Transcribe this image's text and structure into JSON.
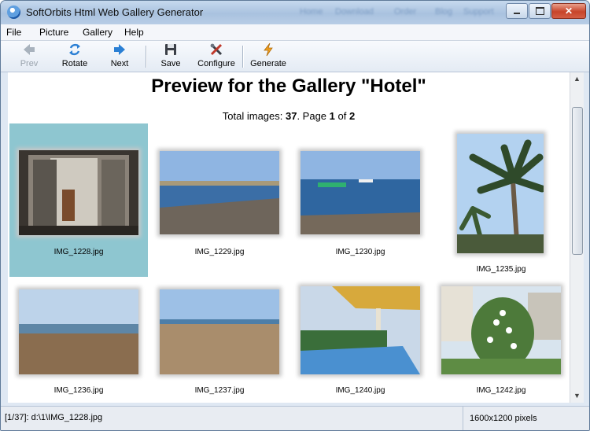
{
  "window": {
    "title": "SoftOrbits Html Web Gallery Generator",
    "controls": {
      "minimize": "minimize",
      "maximize": "maximize",
      "close": "✕"
    }
  },
  "background_blur_text": [
    "Home",
    "Download",
    "Order",
    "Blog",
    "Support"
  ],
  "menu": {
    "items": [
      "File",
      "Picture",
      "Gallery",
      "Help"
    ]
  },
  "toolbar": {
    "prev": {
      "label": "Prev",
      "enabled": false,
      "icon": "left-arrow-icon"
    },
    "rotate": {
      "label": "Rotate",
      "enabled": true,
      "icon": "rotate-icon"
    },
    "next": {
      "label": "Next",
      "enabled": true,
      "icon": "right-arrow-icon"
    },
    "save": {
      "label": "Save",
      "enabled": true,
      "icon": "floppy-disk-icon"
    },
    "configure": {
      "label": "Configure",
      "enabled": true,
      "icon": "tools-icon"
    },
    "generate": {
      "label": "Generate",
      "enabled": true,
      "icon": "lightning-icon"
    }
  },
  "gallery": {
    "title": "Preview for the Gallery \"Hotel\"",
    "total_label": "Total images: ",
    "total_images": "37",
    "page_label": ". Page ",
    "page": "1",
    "of_label": " of ",
    "page_count": "2",
    "selected_index": 0,
    "images": [
      {
        "filename": "IMG_1228.jpg",
        "scene": "lobby"
      },
      {
        "filename": "IMG_1229.jpg",
        "scene": "beach"
      },
      {
        "filename": "IMG_1230.jpg",
        "scene": "sea"
      },
      {
        "filename": "IMG_1235.jpg",
        "scene": "palm"
      },
      {
        "filename": "IMG_1236.jpg",
        "scene": "shore"
      },
      {
        "filename": "IMG_1237.jpg",
        "scene": "sand"
      },
      {
        "filename": "IMG_1240.jpg",
        "scene": "pool"
      },
      {
        "filename": "IMG_1242.jpg",
        "scene": "garden"
      }
    ]
  },
  "statusbar": {
    "file_info": "[1/37]: d:\\1\\IMG_1228.jpg",
    "dimensions": "1600x1200 pixels"
  },
  "colors": {
    "selection": "#8ec6d0",
    "accent": "#3d7fd1"
  }
}
